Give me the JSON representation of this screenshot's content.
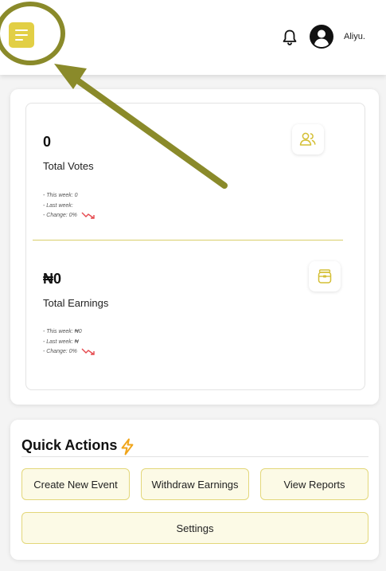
{
  "header": {
    "user_name": "Aliyu."
  },
  "stats": {
    "votes": {
      "value": "0",
      "label": "Total Votes",
      "this_week": "- This week: 0",
      "last_week": "- Last week:",
      "change": "- Change: 0%"
    },
    "earnings": {
      "value": "₦0",
      "label": "Total Earnings",
      "this_week": "- This week: ₦0",
      "last_week": "- Last week: ₦",
      "change": "- Change: 0%"
    }
  },
  "quick_actions": {
    "title": "Quick Actions",
    "buttons": {
      "create_event": "Create New Event",
      "withdraw": "Withdraw Earnings",
      "reports": "View Reports",
      "settings": "Settings"
    }
  },
  "colors": {
    "accent": "#e2cf45",
    "annotation": "#8a8a2a",
    "trend_down": "#e5484d",
    "button_bg": "#fcfae6",
    "button_border": "#e3d77a"
  },
  "icons": {
    "menu": "hamburger-menu-icon",
    "bell": "bell-icon",
    "avatar": "user-avatar-icon",
    "votes": "users-icon",
    "earnings": "wallet-icon",
    "trend": "trend-down-icon",
    "bolt": "lightning-bolt-icon"
  }
}
